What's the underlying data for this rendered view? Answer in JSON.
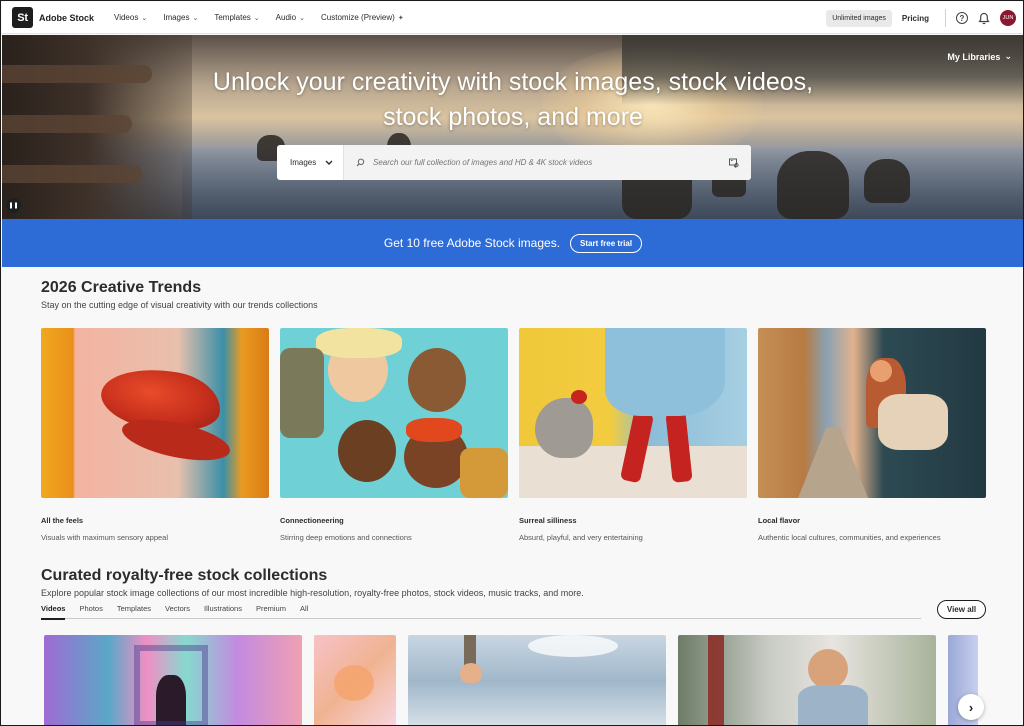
{
  "brand": {
    "logo_text": "St",
    "name": "Adobe Stock"
  },
  "nav": {
    "items": [
      {
        "label": "Videos"
      },
      {
        "label": "Images"
      },
      {
        "label": "Templates"
      },
      {
        "label": "Audio"
      },
      {
        "label": "Customize (Preview)"
      }
    ],
    "unlimited_label": "Unlimited images",
    "pricing_label": "Pricing",
    "help_glyph": "?",
    "avatar_initials": "JUN"
  },
  "hero": {
    "title_line1": "Unlock your creativity with stock images, stock videos,",
    "title_line2": "stock photos, and more",
    "my_libraries": "My Libraries",
    "search": {
      "category": "Images",
      "placeholder": "Search our full collection of images and HD & 4K stock videos"
    }
  },
  "promo": {
    "text": "Get 10 free Adobe Stock images.",
    "button": "Start free trial"
  },
  "trends": {
    "title": "2026 Creative Trends",
    "subtitle": "Stay on the cutting edge of visual creativity with our trends collections",
    "cards": [
      {
        "title": "All the feels",
        "subtitle": "Visuals with maximum sensory appeal"
      },
      {
        "title": "Connectioneering",
        "subtitle": "Stirring deep emotions and connections"
      },
      {
        "title": "Surreal silliness",
        "subtitle": "Absurd, playful, and very entertaining"
      },
      {
        "title": "Local flavor",
        "subtitle": "Authentic local cultures, communities, and experiences"
      }
    ]
  },
  "curated": {
    "title": "Curated royalty-free stock collections",
    "subtitle": "Explore popular stock image collections of our most incredible high-resolution, royalty-free photos, stock videos, music tracks, and more.",
    "tabs": [
      {
        "label": "Videos"
      },
      {
        "label": "Photos"
      },
      {
        "label": "Templates"
      },
      {
        "label": "Vectors"
      },
      {
        "label": "Illustrations"
      },
      {
        "label": "Premium"
      },
      {
        "label": "All"
      }
    ],
    "active_tab": "Videos",
    "view_all": "View all"
  },
  "colors": {
    "promo_blue": "#2d6bd6",
    "avatar": "#8a1630"
  }
}
